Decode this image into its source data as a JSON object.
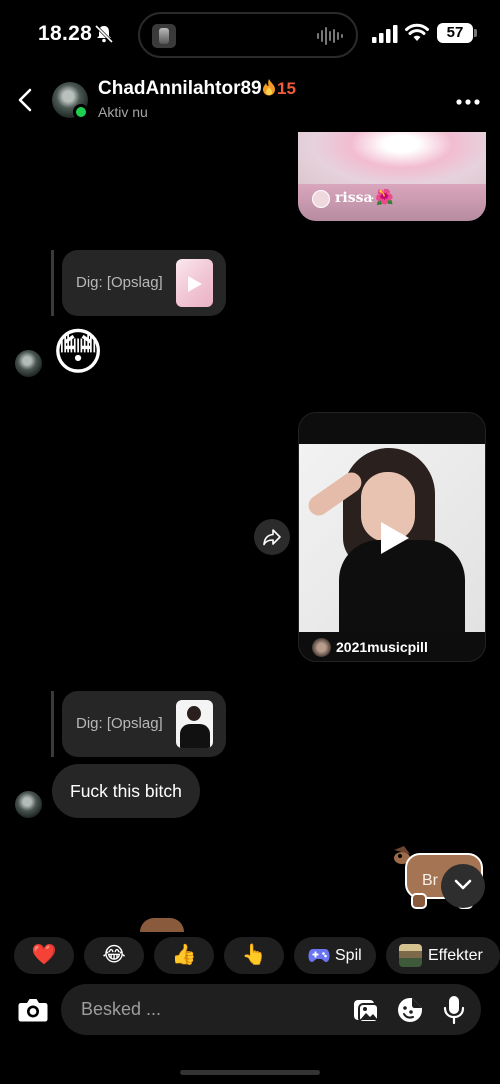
{
  "status_bar": {
    "time": "18.28",
    "battery": "57"
  },
  "header": {
    "contact_name": "ChadAnnilahtor89",
    "streak_count": "15",
    "presence": "Aktiv nu"
  },
  "messages": {
    "shared_post_top": {
      "username": "rissa",
      "flower": "·🌺"
    },
    "reply_ref_1": {
      "text": "Dig: [Opslag]"
    },
    "emoji_reaction": "😳",
    "shared_video": {
      "username": "2021musicpill"
    },
    "reply_ref_2": {
      "text": "Dig: [Opslag]"
    },
    "text_message": "Fuck this bitch",
    "sticker_text": "Br"
  },
  "quick_reactions": {
    "heart": "❤️",
    "laugh": "😂",
    "thumbs_up": "👍",
    "point": "👆",
    "games_label": "Spil",
    "effects_label": "Effekter"
  },
  "composer": {
    "placeholder": "Besked ..."
  },
  "colors": {
    "background": "#000000",
    "bubble": "#262626",
    "online": "#1fcf4f",
    "streak": "#f25b3a",
    "secondary_text": "#a5a5a5"
  },
  "icons": [
    "bell-muted-icon",
    "waveform-icon",
    "signal-icon",
    "wifi-icon",
    "back-icon",
    "fire-icon",
    "more-icon",
    "share-icon",
    "chevron-down-icon",
    "game-controller-icon",
    "camera-icon",
    "gallery-icon",
    "sticker-icon",
    "mic-icon"
  ]
}
